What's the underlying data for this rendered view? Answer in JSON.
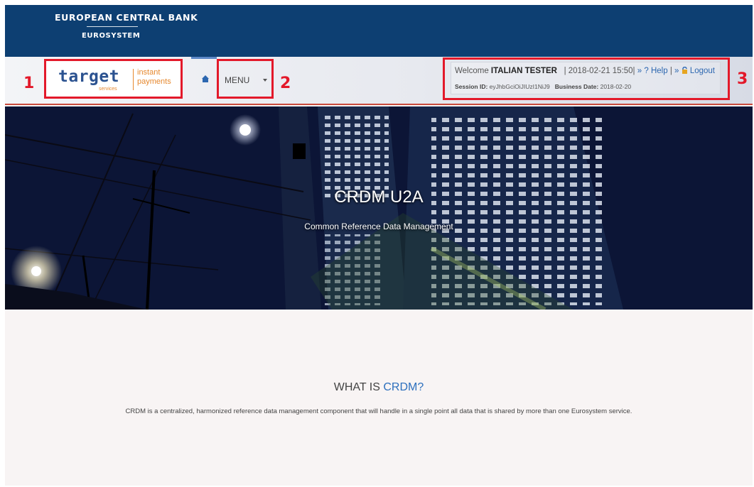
{
  "header": {
    "title": "EUROPEAN CENTRAL BANK",
    "subtitle": "EUROSYSTEM"
  },
  "logo": {
    "wordmark": "target",
    "services": "services",
    "product_line1": "instant",
    "product_line2": "payments"
  },
  "annotations": {
    "marker1": "1",
    "marker2": "2",
    "marker3": "3"
  },
  "nav": {
    "home_icon": "home-icon",
    "menu_label": "MENU"
  },
  "user": {
    "welcome": "Welcome",
    "name": "ITALIAN TESTER",
    "datetime": "| 2018-02-21 15:50|",
    "help_prefix": "»",
    "help_label": "? Help",
    "sep": "|",
    "logout_prefix": "»",
    "logout_label": "Logout",
    "session_label": "Session ID:",
    "session_value": "eyJhbGciOiJIUzI1NiJ9",
    "business_label": "Business Date:",
    "business_value": "2018-02-20"
  },
  "hero": {
    "title": "CRDM U2A",
    "subtitle": "Common Reference Data Management"
  },
  "about": {
    "title_prefix": "WHAT IS",
    "title_accent": "CRDM?",
    "text": "CRDM is a centralized, harmonized reference data management component that will handle in a single point all data that is shared by more than one Eurosystem service."
  },
  "colors": {
    "header_bg": "#0d3f72",
    "highlight": "#e3192a",
    "link": "#2c67b0",
    "accent": "#2c6fbd"
  }
}
